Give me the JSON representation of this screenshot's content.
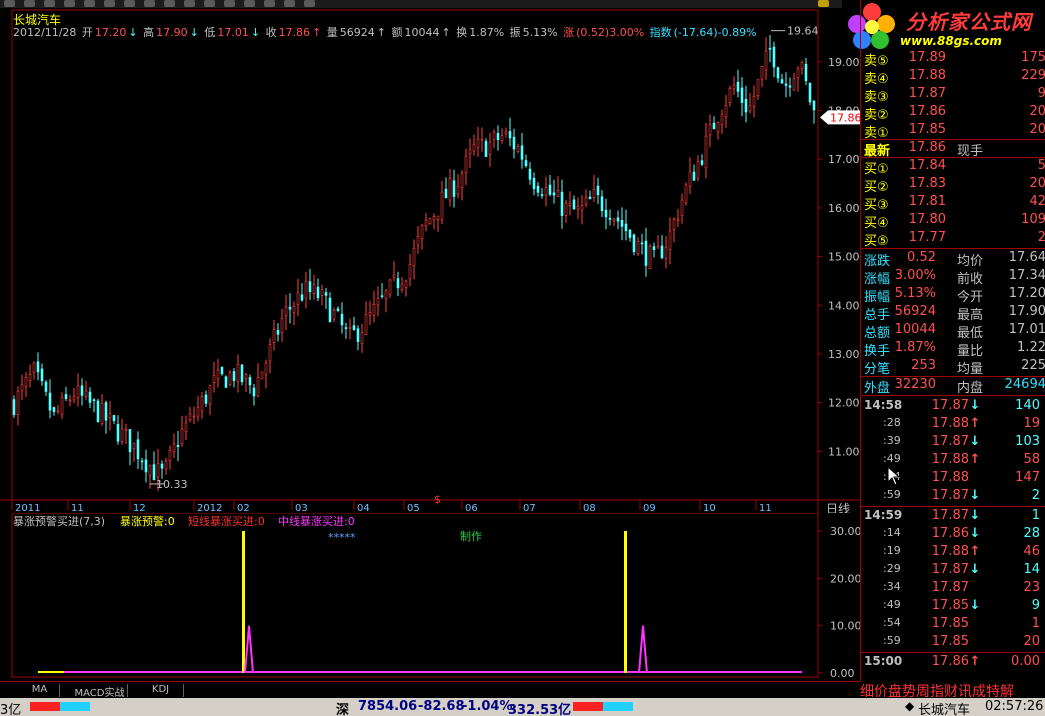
{
  "stock_name": "长城汽车",
  "ohlc": {
    "date": "2012/11/28",
    "open_label": "开",
    "open": "17.20",
    "high_label": "高",
    "high": "17.90",
    "low_label": "低",
    "low": "17.01",
    "close_label": "收",
    "close": "17.86",
    "vol_label": "量",
    "vol": "56924",
    "amt_label": "额",
    "amt": "10044",
    "turn_label": "换",
    "turn": "1.87%",
    "amp_label": "振",
    "amp": "5.13%",
    "chg_label": "涨",
    "chg": "(0.52)3.00%",
    "idx_label": "指数",
    "idx": "(-17.64)-0.89%"
  },
  "price_axis": [
    "19.00",
    "18.00",
    "17.00",
    "16.00",
    "15.00",
    "14.00",
    "13.00",
    "12.00",
    "11.00"
  ],
  "current_price_tag": "17.86",
  "high_mark": "19.64",
  "low_mark": "10.33",
  "time_axis": [
    "2011",
    "11",
    "12",
    "2012",
    "02",
    "03",
    "04",
    "05",
    "06",
    "07",
    "08",
    "09",
    "10",
    "11"
  ],
  "period_label": "日线",
  "indicator": {
    "name": "暴涨预警买进(7,3)",
    "v1": "暴涨预警:0",
    "v2": "短线暴涨买进:0",
    "v3": "中线暴涨买进:0",
    "stars": "*****",
    "maker": "制作",
    "axis": [
      "30.00",
      "20.00",
      "10.00",
      "0.00"
    ]
  },
  "tabs": [
    "MA",
    "MACD实战",
    "KDJ"
  ],
  "logo": {
    "text": "分析家公式网",
    "url": "www.88gs.com"
  },
  "order_book": {
    "sell": [
      {
        "label": "卖⑤",
        "price": "17.89",
        "vol": "175"
      },
      {
        "label": "卖④",
        "price": "17.88",
        "vol": "229"
      },
      {
        "label": "卖③",
        "price": "17.87",
        "vol": "9"
      },
      {
        "label": "卖②",
        "price": "17.86",
        "vol": "20"
      },
      {
        "label": "卖①",
        "price": "17.85",
        "vol": "20"
      }
    ],
    "latest": {
      "label": "最新",
      "price": "17.86",
      "unit": "现手"
    },
    "buy": [
      {
        "label": "买①",
        "price": "17.84",
        "vol": "5"
      },
      {
        "label": "买②",
        "price": "17.83",
        "vol": "20"
      },
      {
        "label": "买③",
        "price": "17.81",
        "vol": "42"
      },
      {
        "label": "买④",
        "price": "17.80",
        "vol": "109"
      },
      {
        "label": "买⑤",
        "price": "17.77",
        "vol": "2"
      }
    ]
  },
  "stats": [
    {
      "l1": "涨跌",
      "v1": "0.52",
      "l2": "均价",
      "v2": "17.64"
    },
    {
      "l1": "涨幅",
      "v1": "3.00%",
      "l2": "前收",
      "v2": "17.34"
    },
    {
      "l1": "振幅",
      "v1": "5.13%",
      "l2": "今开",
      "v2": "17.20"
    },
    {
      "l1": "总手",
      "v1": "56924",
      "l2": "最高",
      "v2": "17.90"
    },
    {
      "l1": "总额",
      "v1": "10044",
      "l2": "最低",
      "v2": "17.01"
    },
    {
      "l1": "换手",
      "v1": "1.87%",
      "l2": "量比",
      "v2": "1.22"
    },
    {
      "l1": "分笔",
      "v1": "253",
      "l2": "均量",
      "v2": "225"
    }
  ],
  "outer_inner": {
    "l1": "外盘",
    "v1": "32230",
    "l2": "内盘",
    "v2": "24694"
  },
  "ticks": [
    {
      "t": "14:58",
      "p": "17.87",
      "dir": "down",
      "v": "140"
    },
    {
      "t": ":28",
      "p": "17.88",
      "dir": "up",
      "v": "19"
    },
    {
      "t": ":39",
      "p": "17.87",
      "dir": "down",
      "v": "103"
    },
    {
      "t": ":49",
      "p": "17.88",
      "dir": "up",
      "v": "58"
    },
    {
      "t": ":54",
      "p": "17.88",
      "dir": "",
      "v": "147"
    },
    {
      "t": ":59",
      "p": "17.87",
      "dir": "down",
      "v": "2"
    },
    {
      "t": "14:59",
      "p": "17.87",
      "dir": "down",
      "v": "1"
    },
    {
      "t": ":14",
      "p": "17.86",
      "dir": "down",
      "v": "28"
    },
    {
      "t": ":19",
      "p": "17.88",
      "dir": "up",
      "v": "46"
    },
    {
      "t": ":29",
      "p": "17.87",
      "dir": "down",
      "v": "14"
    },
    {
      "t": ":34",
      "p": "17.87",
      "dir": "",
      "v": "23"
    },
    {
      "t": ":49",
      "p": "17.85",
      "dir": "down",
      "v": "9"
    },
    {
      "t": ":54",
      "p": "17.85",
      "dir": "",
      "v": "1"
    },
    {
      "t": ":59",
      "p": "17.85",
      "dir": "",
      "v": "20"
    },
    {
      "t": "15:00",
      "p": "17.86",
      "dir": "up",
      "v": "0.00"
    }
  ],
  "right_tabs": "细价盘势周指财讯成特解",
  "status": {
    "left": "3亿",
    "market": "深",
    "index": "7854.06",
    "chg": "-82.68",
    "pct": "-1.04%",
    "amt": "332.53亿",
    "stock": "长城汽车",
    "time": "02:57:26"
  }
}
